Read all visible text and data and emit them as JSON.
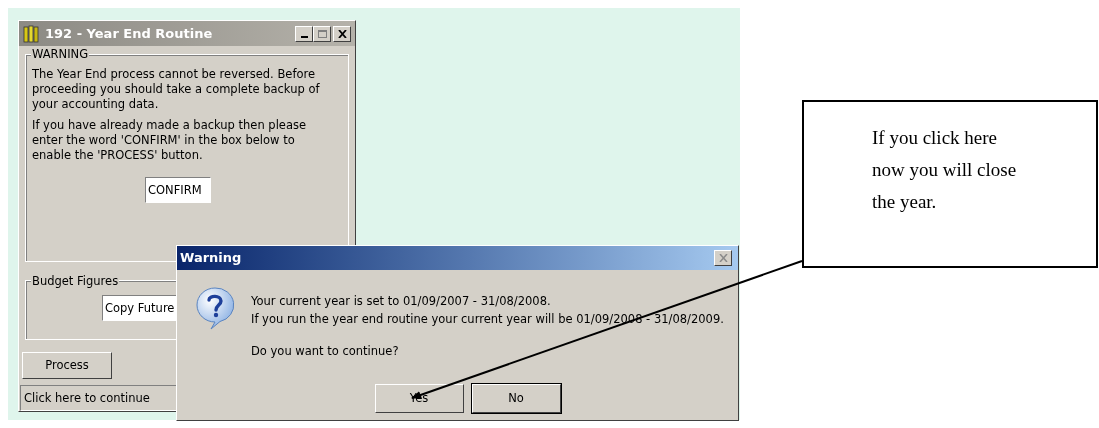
{
  "main_window": {
    "title": "192 - Year End Routine",
    "warning_group": {
      "label": "WARNING",
      "paragraphs": [
        "The Year End process cannot be reversed. Before proceeding you should take a complete backup of your accounting data.",
        "If you have already made a backup then please enter the word 'CONFIRM' in the box below to enable the 'PROCESS' button."
      ],
      "confirm_field": {
        "value": "CONFIRM"
      }
    },
    "budget_group": {
      "label": "Budget Figures",
      "combo": {
        "value": "Copy Future"
      }
    },
    "process_button": "Process",
    "status_bar": "Click here to continue"
  },
  "dialog": {
    "title": "Warning",
    "message_lines": [
      "Your current year is set to 01/09/2007 - 31/08/2008.",
      "If you run the year end routine your current year will be 01/09/2008 - 31/08/2009."
    ],
    "question": "Do you want to continue?",
    "buttons": [
      "Yes",
      "No"
    ]
  },
  "callout": {
    "text": "If you click here now you will close the year."
  }
}
